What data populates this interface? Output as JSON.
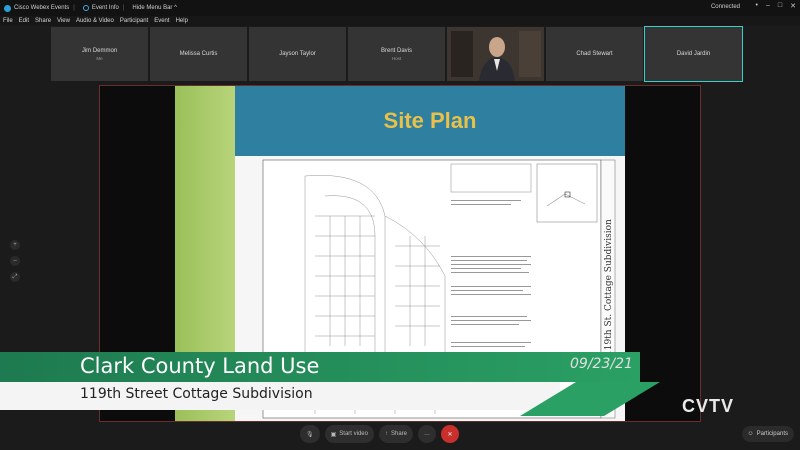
{
  "titlebar": {
    "app": "Cisco Webex Events",
    "event_info": "Event Info",
    "hide_menu": "Hide Menu Bar ^",
    "status": "Connected",
    "controls": [
      "•",
      "–",
      "□",
      "✕"
    ]
  },
  "menu": [
    "File",
    "Edit",
    "Share",
    "View",
    "Audio & Video",
    "Participant",
    "Event",
    "Help"
  ],
  "participants": [
    {
      "name": "Jim Demmon",
      "sub": "Me"
    },
    {
      "name": "Melissa Curtis",
      "sub": ""
    },
    {
      "name": "Jayson Taylor",
      "sub": ""
    },
    {
      "name": "Brent Davis",
      "sub": "Host"
    },
    {
      "name": "",
      "sub": ""
    },
    {
      "name": "Chad Stewart",
      "sub": ""
    },
    {
      "name": "David Jardin",
      "sub": ""
    }
  ],
  "slide": {
    "title": "Site Plan"
  },
  "left_tools": [
    "+",
    "–",
    "⤢"
  ],
  "lower_third": {
    "title": "Clark County Land Use",
    "subtitle": "119th Street Cottage Subdivision",
    "date": "09/23/21",
    "channel": "CVTV"
  },
  "controls": {
    "mute": "",
    "start_video": "Start video",
    "share": "Share",
    "more": "…",
    "leave": "✕"
  },
  "participants_btn": "Participants"
}
